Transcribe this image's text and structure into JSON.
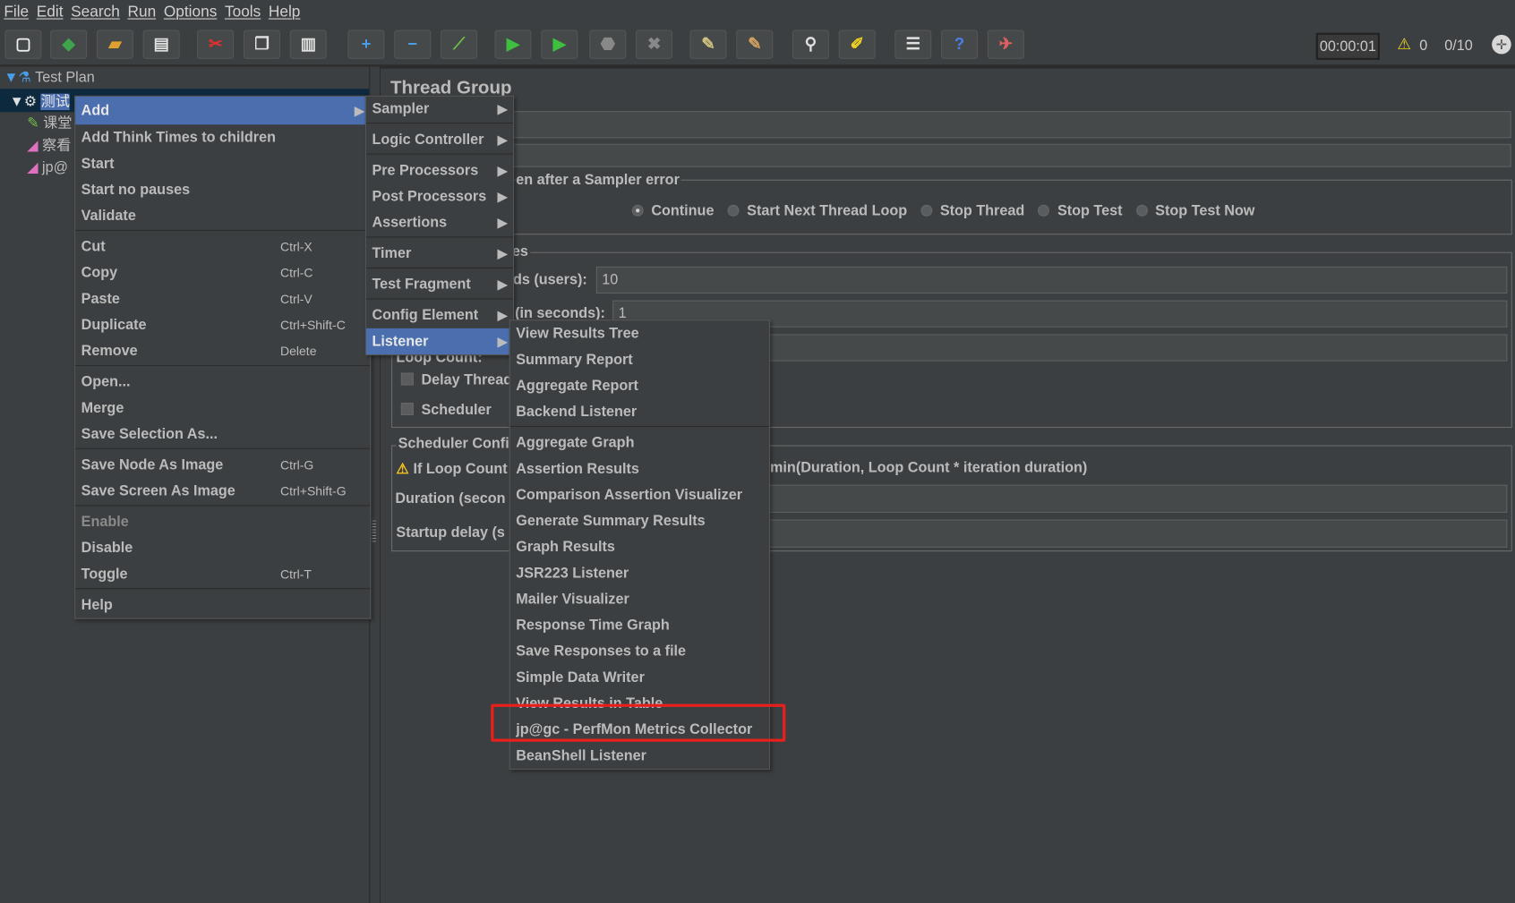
{
  "menubar": [
    "File",
    "Edit",
    "Search",
    "Run",
    "Options",
    "Tools",
    "Help"
  ],
  "toolbar": {
    "buttons": [
      {
        "name": "new-icon",
        "glyph": "▢",
        "color": "#f0f0f0"
      },
      {
        "name": "templates-icon",
        "glyph": "◆",
        "color": "#3fa34d"
      },
      {
        "name": "open-icon",
        "glyph": "▰",
        "color": "#e0a030"
      },
      {
        "name": "save-icon",
        "glyph": "▤",
        "color": "#e0e0e0"
      },
      {
        "name": "cut-icon",
        "glyph": "✂",
        "color": "#e03030"
      },
      {
        "name": "copy-icon",
        "glyph": "❐",
        "color": "#e0e0e0"
      },
      {
        "name": "paste-icon",
        "glyph": "▥",
        "color": "#e0e0e0"
      },
      {
        "name": "expand-icon",
        "glyph": "+",
        "color": "#4a9ee8"
      },
      {
        "name": "collapse-icon",
        "glyph": "−",
        "color": "#4a9ee8"
      },
      {
        "name": "toggle-icon",
        "glyph": "⟋",
        "color": "#6fbf4a"
      },
      {
        "name": "start-icon",
        "glyph": "▶",
        "color": "#3fbf3f"
      },
      {
        "name": "start-no-pauses-icon",
        "glyph": "▶",
        "color": "#3fbf3f"
      },
      {
        "name": "stop-icon",
        "glyph": "⬣",
        "color": "#888888"
      },
      {
        "name": "shutdown-icon",
        "glyph": "✖",
        "color": "#888888"
      },
      {
        "name": "clear-icon",
        "glyph": "✎",
        "color": "#d0c080"
      },
      {
        "name": "clear-all-icon",
        "glyph": "✎",
        "color": "#d0a060"
      },
      {
        "name": "search-icon",
        "glyph": "⚲",
        "color": "#e0e0e0"
      },
      {
        "name": "reset-search-icon",
        "glyph": "✐",
        "color": "#f0d020"
      },
      {
        "name": "function-helper-icon",
        "glyph": "☰",
        "color": "#e0e0e0"
      },
      {
        "name": "help-icon",
        "glyph": "?",
        "color": "#4a7ee8"
      },
      {
        "name": "remote-icon",
        "glyph": "✈",
        "color": "#e06060"
      }
    ],
    "timer": "00:00:01",
    "warning_count": "0",
    "threads": "0/10"
  },
  "tree": {
    "items": [
      {
        "label": "Test Plan",
        "icon": "flask-icon"
      },
      {
        "label": "测试",
        "icon": "gear-icon",
        "selected": true
      },
      {
        "label": "课堂",
        "icon": "pipette-icon"
      },
      {
        "label": "察看",
        "icon": "listener-icon"
      },
      {
        "label": "jp@",
        "icon": "listener-icon"
      }
    ]
  },
  "panel": {
    "title": "Thread Group",
    "sampler_error_label": "en after a Sampler error",
    "radios": [
      {
        "label": "Continue",
        "checked": true
      },
      {
        "label": "Start Next Thread Loop",
        "checked": false
      },
      {
        "label": "Stop Thread",
        "checked": false
      },
      {
        "label": "Stop Test",
        "checked": false
      },
      {
        "label": "Stop Test Now",
        "checked": false
      }
    ],
    "thread_props_label": "es",
    "threads_label": "ds (users):",
    "threads_value": "10",
    "rampup_label": "(in seconds):",
    "rampup_value": "1",
    "loop_label": "Loop Count:",
    "delay_label": "Delay Thread",
    "scheduler_label": "Scheduler",
    "scheduler_config_label": "Scheduler Confi",
    "loop_warning_label": "If Loop Count",
    "loop_warning_tail": "min(Duration, Loop Count * iteration duration)",
    "duration_label": "Duration (secon",
    "startup_label": "Startup delay (s"
  },
  "context_menu": [
    {
      "label": "Add",
      "arrow": true,
      "selected": true
    },
    {
      "label": "Add Think Times to children"
    },
    {
      "label": "Start"
    },
    {
      "label": "Start no pauses"
    },
    {
      "label": "Validate"
    },
    {
      "separator": true
    },
    {
      "label": "Cut",
      "shortcut": "Ctrl-X"
    },
    {
      "label": "Copy",
      "shortcut": "Ctrl-C"
    },
    {
      "label": "Paste",
      "shortcut": "Ctrl-V"
    },
    {
      "label": "Duplicate",
      "shortcut": "Ctrl+Shift-C"
    },
    {
      "label": "Remove",
      "shortcut": "Delete"
    },
    {
      "separator": true
    },
    {
      "label": "Open..."
    },
    {
      "label": "Merge"
    },
    {
      "label": "Save Selection As..."
    },
    {
      "separator": true
    },
    {
      "label": "Save Node As Image",
      "shortcut": "Ctrl-G"
    },
    {
      "label": "Save Screen As Image",
      "shortcut": "Ctrl+Shift-G"
    },
    {
      "separator": true
    },
    {
      "label": "Enable",
      "disabled": true
    },
    {
      "label": "Disable"
    },
    {
      "label": "Toggle",
      "shortcut": "Ctrl-T"
    },
    {
      "separator": true
    },
    {
      "label": "Help"
    }
  ],
  "add_submenu": [
    {
      "label": "Sampler",
      "arrow": true
    },
    {
      "separator": true
    },
    {
      "label": "Logic Controller",
      "arrow": true
    },
    {
      "separator": true
    },
    {
      "label": "Pre Processors",
      "arrow": true
    },
    {
      "label": "Post Processors",
      "arrow": true
    },
    {
      "label": "Assertions",
      "arrow": true
    },
    {
      "separator": true
    },
    {
      "label": "Timer",
      "arrow": true
    },
    {
      "separator": true
    },
    {
      "label": "Test Fragment",
      "arrow": true
    },
    {
      "separator": true
    },
    {
      "label": "Config Element",
      "arrow": true
    },
    {
      "label": "Listener",
      "arrow": true,
      "selected": true
    }
  ],
  "listener_submenu": [
    {
      "label": "View Results Tree"
    },
    {
      "label": "Summary Report"
    },
    {
      "label": "Aggregate Report"
    },
    {
      "label": "Backend Listener"
    },
    {
      "separator": true
    },
    {
      "label": "Aggregate Graph"
    },
    {
      "label": "Assertion Results"
    },
    {
      "label": "Comparison Assertion Visualizer"
    },
    {
      "label": "Generate Summary Results"
    },
    {
      "label": "Graph Results"
    },
    {
      "label": "JSR223 Listener"
    },
    {
      "label": "Mailer Visualizer"
    },
    {
      "label": "Response Time Graph"
    },
    {
      "label": "Save Responses to a file"
    },
    {
      "label": "Simple Data Writer"
    },
    {
      "label": "View Results in Table"
    },
    {
      "label": "jp@gc - PerfMon Metrics Collector",
      "highlighted_annotation": true
    },
    {
      "label": "BeanShell Listener"
    }
  ],
  "colors": {
    "background": "#3c3f41",
    "selection": "#4b6eaf",
    "annotation": "#e8201c",
    "text": "#bbbbbb"
  }
}
